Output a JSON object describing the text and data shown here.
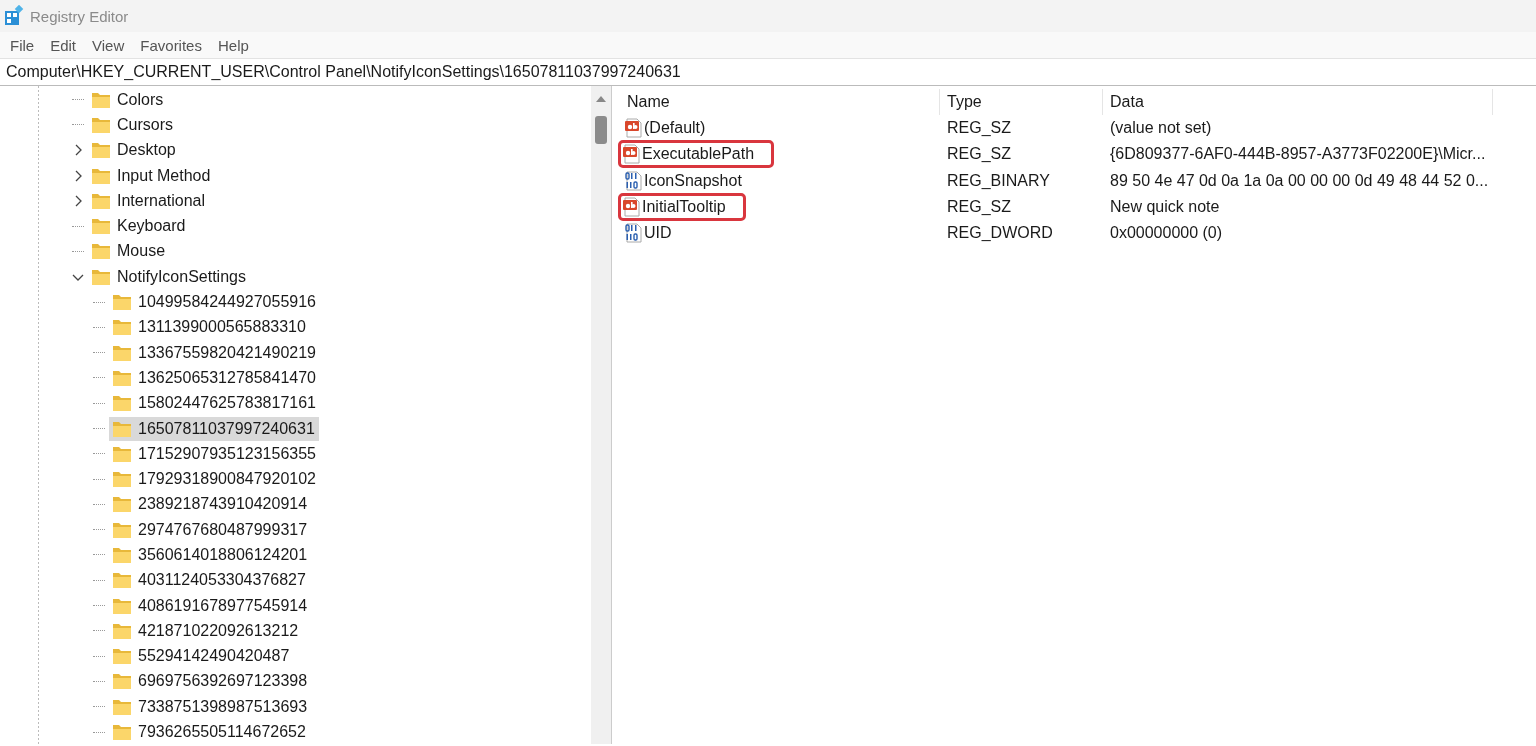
{
  "window": {
    "title": "Registry Editor"
  },
  "menu": [
    "File",
    "Edit",
    "View",
    "Favorites",
    "Help"
  ],
  "address": "Computer\\HKEY_CURRENT_USER\\Control Panel\\NotifyIconSettings\\16507811037997240631",
  "tree": [
    {
      "kind": "leaf",
      "label": "Colors",
      "selected": false
    },
    {
      "kind": "leaf",
      "label": "Cursors",
      "selected": false
    },
    {
      "kind": "branch",
      "label": "Desktop",
      "expanded": false,
      "selected": false
    },
    {
      "kind": "branch",
      "label": "Input Method",
      "expanded": false,
      "selected": false
    },
    {
      "kind": "branch",
      "label": "International",
      "expanded": false,
      "selected": false
    },
    {
      "kind": "leaf",
      "label": "Keyboard",
      "selected": false
    },
    {
      "kind": "leaf",
      "label": "Mouse",
      "selected": false
    },
    {
      "kind": "branch",
      "label": "NotifyIconSettings",
      "expanded": true,
      "selected": false,
      "children": [
        {
          "kind": "leaf",
          "label": "10499584244927055916",
          "selected": false
        },
        {
          "kind": "leaf",
          "label": "1311399000565883310",
          "selected": false
        },
        {
          "kind": "leaf",
          "label": "13367559820421490219",
          "selected": false
        },
        {
          "kind": "leaf",
          "label": "13625065312785841470",
          "selected": false
        },
        {
          "kind": "leaf",
          "label": "15802447625783817161",
          "selected": false
        },
        {
          "kind": "leaf",
          "label": "16507811037997240631",
          "selected": true
        },
        {
          "kind": "leaf",
          "label": "17152907935123156355",
          "selected": false
        },
        {
          "kind": "leaf",
          "label": "17929318900847920102",
          "selected": false
        },
        {
          "kind": "leaf",
          "label": "2389218743910420914",
          "selected": false
        },
        {
          "kind": "leaf",
          "label": "2974767680487999317",
          "selected": false
        },
        {
          "kind": "leaf",
          "label": "3560614018806124201",
          "selected": false
        },
        {
          "kind": "leaf",
          "label": "4031124053304376827",
          "selected": false
        },
        {
          "kind": "leaf",
          "label": "4086191678977545914",
          "selected": false
        },
        {
          "kind": "leaf",
          "label": "421871022092613212",
          "selected": false
        },
        {
          "kind": "leaf",
          "label": "55294142490420487",
          "selected": false
        },
        {
          "kind": "leaf",
          "label": "6969756392697123398",
          "selected": false
        },
        {
          "kind": "leaf",
          "label": "7338751398987513693",
          "selected": false
        },
        {
          "kind": "leaf",
          "label": "7936265505114672652",
          "selected": false
        }
      ]
    }
  ],
  "table": {
    "columns": [
      "Name",
      "Type",
      "Data"
    ],
    "rows": [
      {
        "kind": "string",
        "name": "(Default)",
        "type": "REG_SZ",
        "data": "(value not set)",
        "highlighted": false
      },
      {
        "kind": "string",
        "name": "ExecutablePath",
        "type": "REG_SZ",
        "data": "{6D809377-6AF0-444B-8957-A3773F02200E}\\Micr...",
        "highlighted": true
      },
      {
        "kind": "binary",
        "name": "IconSnapshot",
        "type": "REG_BINARY",
        "data": "89 50 4e 47 0d 0a 1a 0a 00 00 00 0d 49 48 44 52 0...",
        "highlighted": false
      },
      {
        "kind": "string",
        "name": "InitialTooltip",
        "type": "REG_SZ",
        "data": "New quick note",
        "highlighted": true
      },
      {
        "kind": "binary",
        "name": "UID",
        "type": "REG_DWORD",
        "data": "0x00000000 (0)",
        "highlighted": false
      }
    ]
  }
}
